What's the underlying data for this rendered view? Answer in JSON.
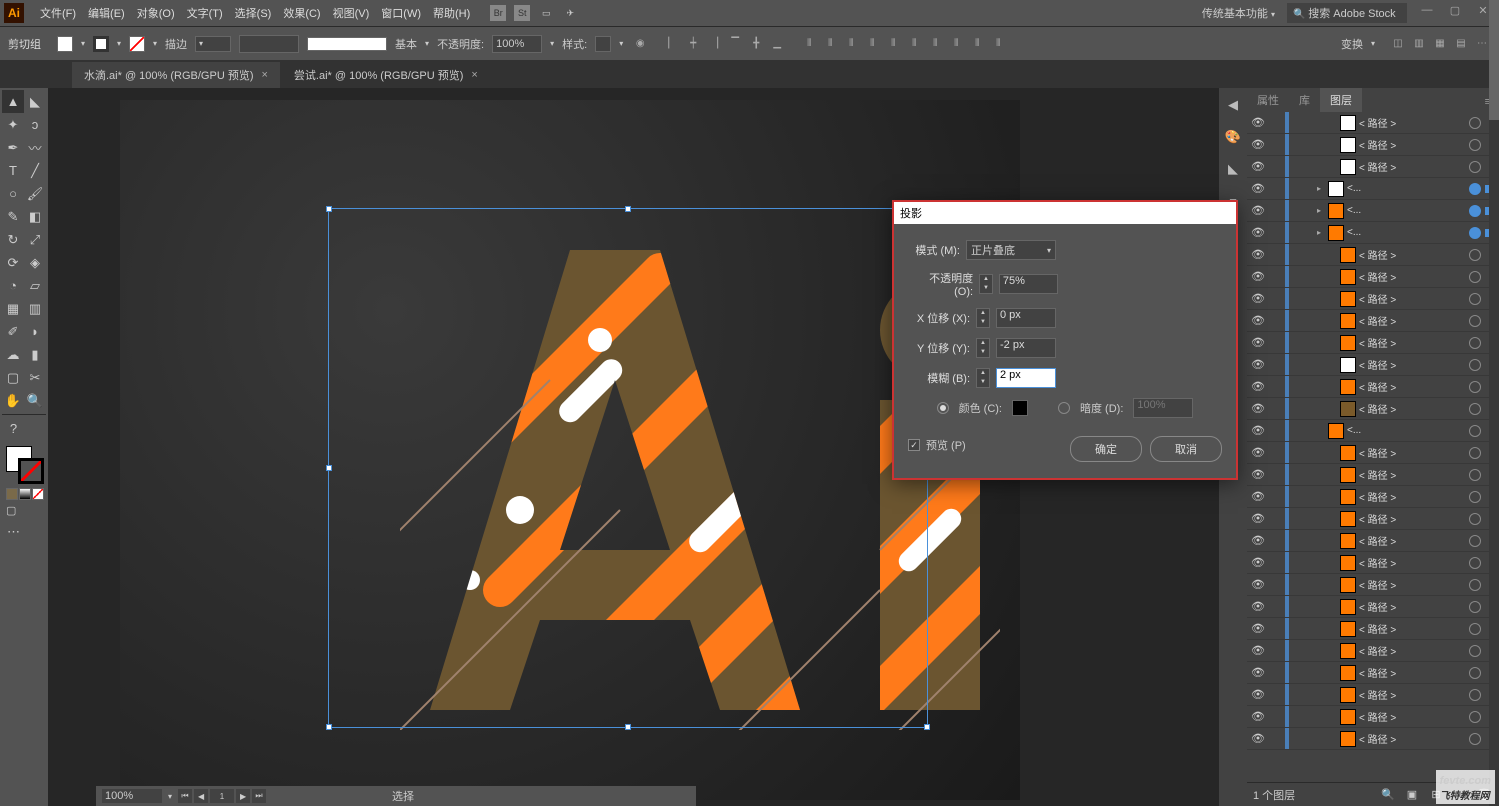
{
  "menubar": {
    "items": [
      "文件(F)",
      "编辑(E)",
      "对象(O)",
      "文字(T)",
      "选择(S)",
      "效果(C)",
      "视图(V)",
      "窗口(W)",
      "帮助(H)"
    ]
  },
  "workspace": "传统基本功能",
  "searchStock": "搜索 Adobe Stock",
  "optbar": {
    "selection": "剪切组",
    "strokeLabel": "描边",
    "strokeVal": "",
    "profileLabel": "基本",
    "opacityLabel": "不透明度:",
    "opacityVal": "100%",
    "styleLabel": "样式:",
    "transformLabel": "变换"
  },
  "tabs": [
    {
      "label": "水滴.ai* @ 100% (RGB/GPU 预览)",
      "active": true
    },
    {
      "label": "尝试.ai* @ 100% (RGB/GPU 预览)",
      "active": false
    }
  ],
  "statusbar": {
    "zoom": "100%",
    "page": "1",
    "tool": "选择"
  },
  "panelTabs": [
    "属性",
    "库",
    "图层"
  ],
  "activePanel": 2,
  "layersFooter": {
    "count": "1 个图层"
  },
  "layers": [
    {
      "indent": 3,
      "name": "< 路径 >",
      "thumb": "#fff",
      "sel": false
    },
    {
      "indent": 3,
      "name": "< 路径 >",
      "thumb": "#fff",
      "sel": false
    },
    {
      "indent": 3,
      "name": "< 路径 >",
      "thumb": "#fff",
      "sel": false
    },
    {
      "indent": 2,
      "expand": true,
      "name": "<...",
      "thumb": "#fff",
      "sel": true,
      "target": true
    },
    {
      "indent": 2,
      "expand": true,
      "name": "<...",
      "thumb": "#ff7a00",
      "sel": true,
      "target": true
    },
    {
      "indent": 2,
      "expand": true,
      "name": "<...",
      "thumb": "#ff7a00",
      "sel": true,
      "target": true
    },
    {
      "indent": 3,
      "name": "< 路径 >",
      "thumb": "#ff7a00",
      "sel": false
    },
    {
      "indent": 3,
      "name": "< 路径 >",
      "thumb": "#ff7a00",
      "sel": false
    },
    {
      "indent": 3,
      "name": "< 路径 >",
      "thumb": "#ff7a00",
      "sel": false
    },
    {
      "indent": 3,
      "name": "< 路径 >",
      "thumb": "#ff7a00",
      "sel": false
    },
    {
      "indent": 3,
      "name": "< 路径 >",
      "thumb": "#ff7a00",
      "sel": false
    },
    {
      "indent": 3,
      "name": "< 路径 >",
      "thumb": "#fff",
      "sel": false
    },
    {
      "indent": 3,
      "name": "< 路径 >",
      "thumb": "#ff7a00",
      "sel": false
    },
    {
      "indent": 3,
      "name": "< 路径 >",
      "thumb": "#7a5a2a",
      "sel": false
    },
    {
      "indent": 2,
      "name": "<...",
      "thumb": "#ff7a00",
      "sel": false
    },
    {
      "indent": 3,
      "name": "< 路径 >",
      "thumb": "#ff7a00",
      "sel": false
    },
    {
      "indent": 3,
      "name": "< 路径 >",
      "thumb": "#ff7a00",
      "sel": false
    },
    {
      "indent": 3,
      "name": "< 路径 >",
      "thumb": "#ff7a00",
      "sel": false
    },
    {
      "indent": 3,
      "name": "< 路径 >",
      "thumb": "#ff7a00",
      "sel": false
    },
    {
      "indent": 3,
      "name": "< 路径 >",
      "thumb": "#ff7a00",
      "sel": false
    },
    {
      "indent": 3,
      "name": "< 路径 >",
      "thumb": "#ff7a00",
      "sel": false
    },
    {
      "indent": 3,
      "name": "< 路径 >",
      "thumb": "#ff7a00",
      "sel": false
    },
    {
      "indent": 3,
      "name": "< 路径 >",
      "thumb": "#ff7a00",
      "sel": false
    },
    {
      "indent": 3,
      "name": "< 路径 >",
      "thumb": "#ff7a00",
      "sel": false
    },
    {
      "indent": 3,
      "name": "< 路径 >",
      "thumb": "#ff7a00",
      "sel": false
    },
    {
      "indent": 3,
      "name": "< 路径 >",
      "thumb": "#ff7a00",
      "sel": false
    },
    {
      "indent": 3,
      "name": "< 路径 >",
      "thumb": "#ff7a00",
      "sel": false
    },
    {
      "indent": 3,
      "name": "< 路径 >",
      "thumb": "#ff7a00",
      "sel": false
    },
    {
      "indent": 3,
      "name": "< 路径 >",
      "thumb": "#ff7a00",
      "sel": false
    }
  ],
  "dialog": {
    "title": "投影",
    "modeLabel": "模式 (M):",
    "modeVal": "正片叠底",
    "opacityLabel": "不透明度 (O):",
    "opacityVal": "75%",
    "xLabel": "X 位移 (X):",
    "xVal": "0 px",
    "yLabel": "Y 位移 (Y):",
    "yVal": "-2 px",
    "blurLabel": "模糊 (B):",
    "blurVal": "2 px",
    "colorLabel": "颜色 (C):",
    "darkLabel": "暗度 (D):",
    "darkVal": "100%",
    "previewLabel": "预览 (P)",
    "okLabel": "确定",
    "cancelLabel": "取消"
  },
  "watermark": {
    "top": "fevte.com",
    "bottom": "飞特教程网"
  }
}
